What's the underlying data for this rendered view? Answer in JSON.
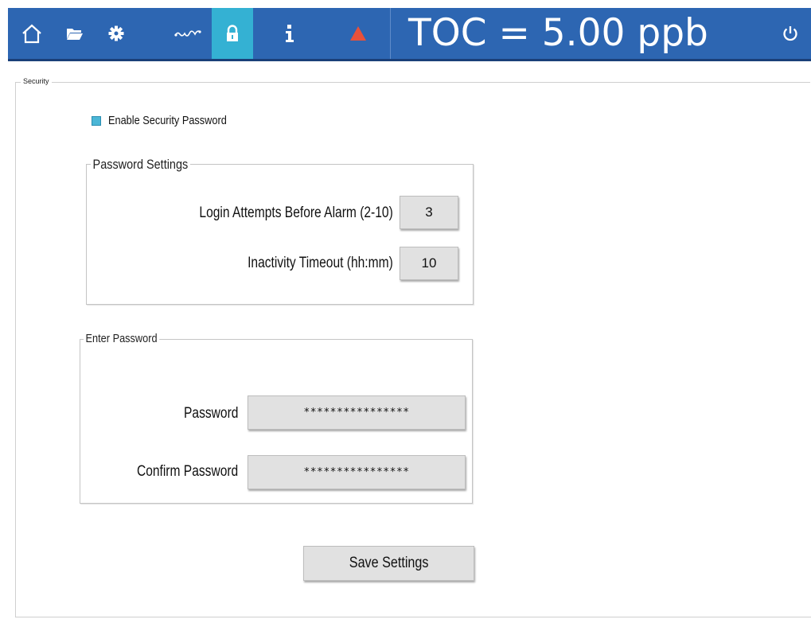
{
  "header": {
    "nav": [
      {
        "icon": "home-icon"
      },
      {
        "icon": "folder-icon"
      },
      {
        "icon": "gear-icon"
      },
      {
        "icon": "trend-icon"
      },
      {
        "icon": "lock-icon",
        "active": true
      },
      {
        "icon": "info-icon"
      },
      {
        "icon": "alarm-icon"
      }
    ],
    "toc_text": "TOC = 5.00 ppb",
    "power_icon": "power-icon",
    "colors": {
      "bar": "#2d66b2",
      "active": "#34b1d3",
      "alarm": "#e8513a"
    }
  },
  "security": {
    "legend": "Security",
    "enable_label": "Enable Security Password",
    "enable_checked": true,
    "password_settings": {
      "legend": "Password Settings",
      "login_attempts_label": "Login Attempts Before Alarm (2-10)",
      "login_attempts_value": "3",
      "timeout_label": "Inactivity Timeout (hh:mm)",
      "timeout_value": "10"
    },
    "enter_password": {
      "legend": "Enter Password",
      "password_label": "Password",
      "password_value": "****************",
      "confirm_label": "Confirm Password",
      "confirm_value": "****************"
    },
    "save_label": "Save Settings"
  }
}
